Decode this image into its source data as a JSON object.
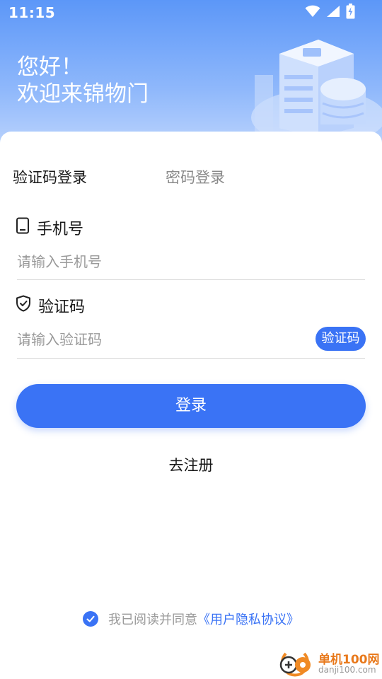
{
  "status_bar": {
    "time": "11:15",
    "icons": [
      "wifi-icon",
      "signal-icon",
      "battery-charging-icon"
    ]
  },
  "header": {
    "greeting_line1": "您好！",
    "greeting_line2": "欢迎来锦物门"
  },
  "tabs": {
    "sms_login": "验证码登录",
    "password_login": "密码登录",
    "active": "sms_login"
  },
  "phone_field": {
    "label": "手机号",
    "placeholder": "请输入手机号",
    "value": "",
    "icon": "phone-icon"
  },
  "code_field": {
    "label": "验证码",
    "placeholder": "请输入验证码",
    "value": "",
    "icon": "shield-check-icon",
    "button_label": "验证码"
  },
  "login_button": {
    "label": "登录"
  },
  "register_link": {
    "label": "去注册"
  },
  "agreement": {
    "checked": true,
    "text": "我已阅读并同意",
    "link_text": "《用户隐私协议》"
  },
  "watermark": {
    "title": "单机100网",
    "url": "danji100.com"
  },
  "colors": {
    "primary": "#3a73f5",
    "header_top": "#5c97f8",
    "header_bottom": "#c6dafd",
    "watermark_orange": "#e8791c"
  }
}
